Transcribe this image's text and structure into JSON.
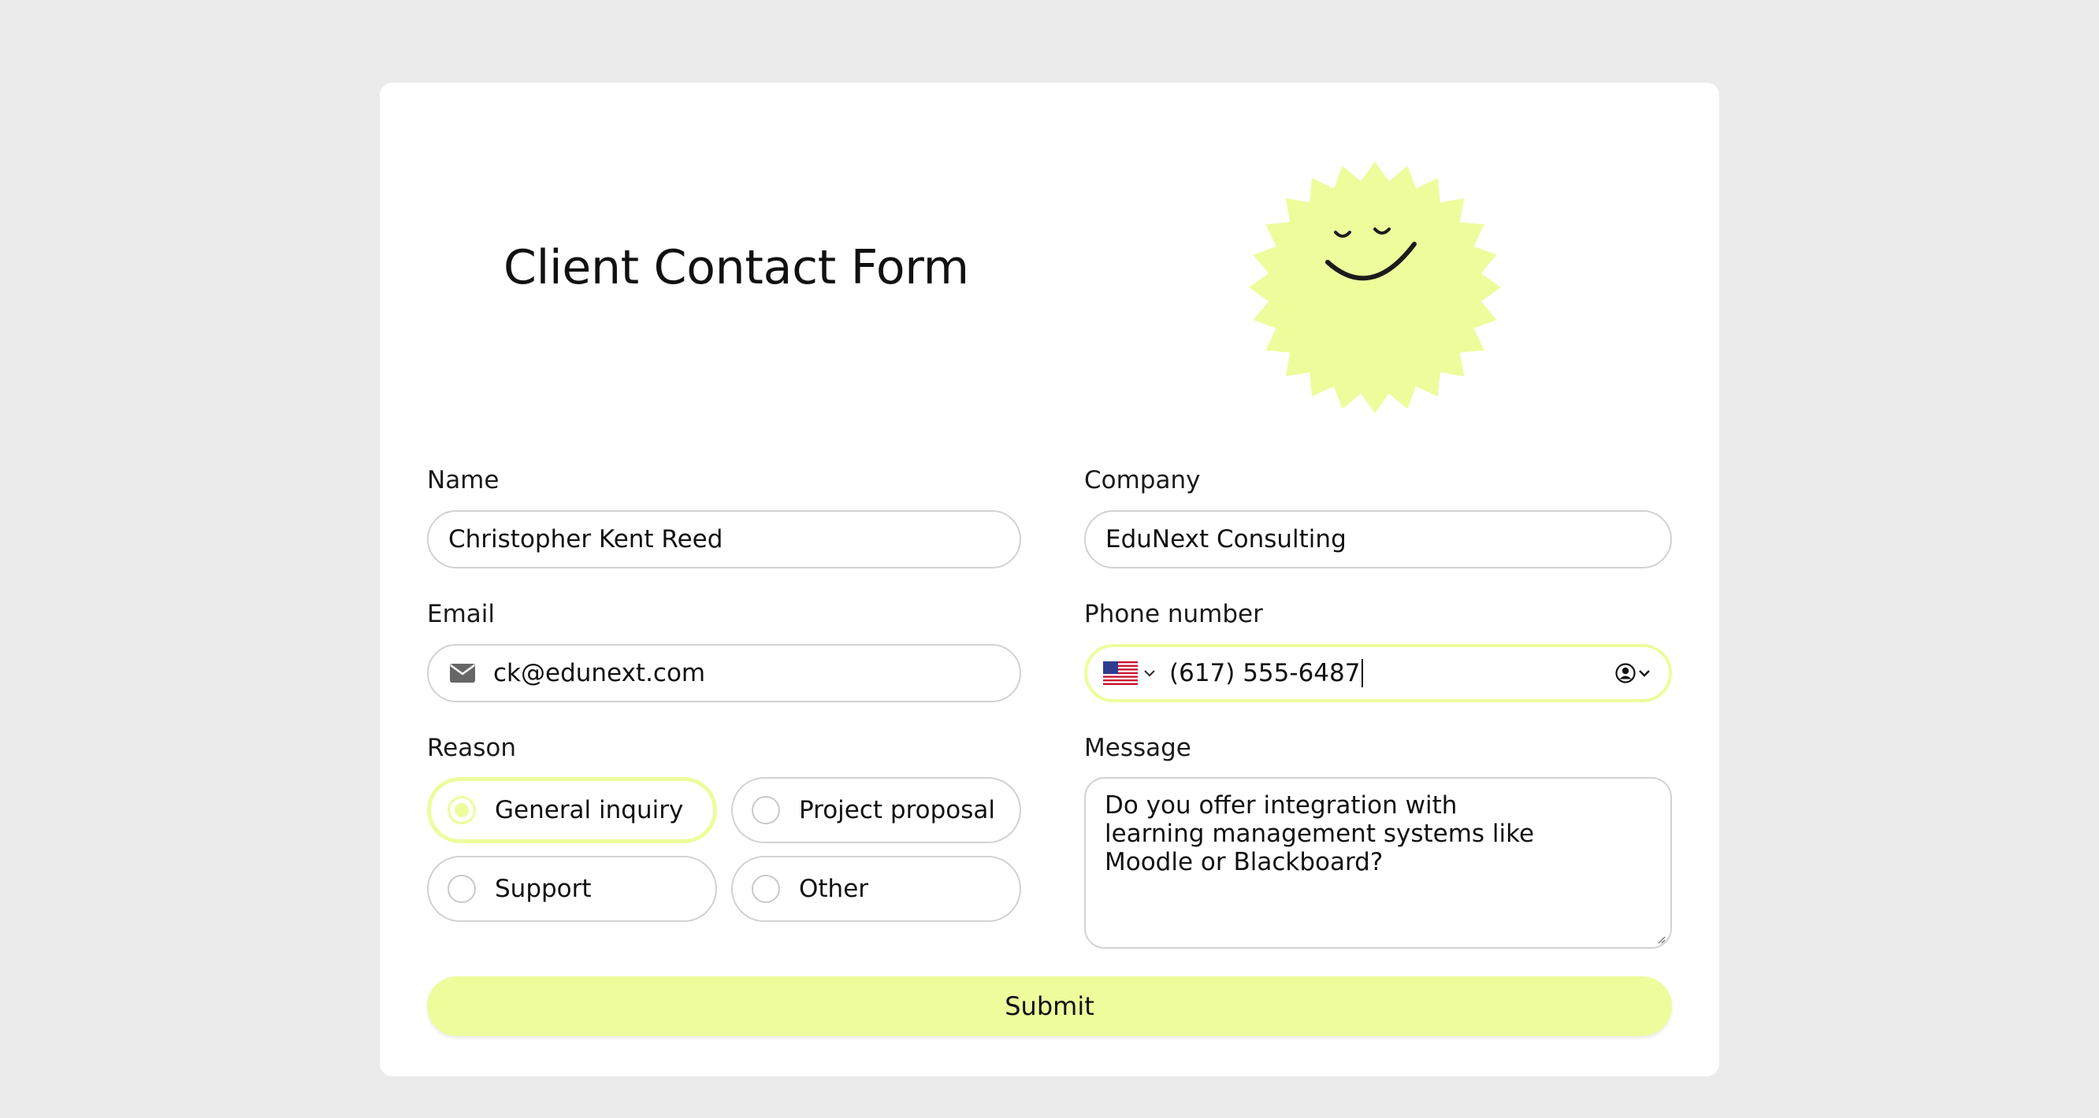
{
  "form": {
    "title": "Client Contact Form",
    "name": {
      "label": "Name",
      "value": "Christopher Kent Reed"
    },
    "company": {
      "label": "Company",
      "value": "EduNext Consulting"
    },
    "email": {
      "label": "Email",
      "value": "ck@edunext.com",
      "icon": "envelope-icon"
    },
    "phone": {
      "label": "Phone number",
      "value": "(617) 555-6487",
      "country_icon": "us-flag-icon",
      "contact_icon": "contact-picker-icon"
    },
    "reason": {
      "label": "Reason",
      "options": [
        "General inquiry",
        "Project proposal",
        "Support",
        "Other"
      ],
      "selected": "General inquiry"
    },
    "message": {
      "label": "Message",
      "value": "Do you offer integration with learning management systems like Moodle or Blackboard?"
    },
    "submit_label": "Submit"
  },
  "colors": {
    "accent": "#eefc9c",
    "background": "#ebebeb",
    "card": "#ffffff",
    "border": "#d2d2d2"
  }
}
